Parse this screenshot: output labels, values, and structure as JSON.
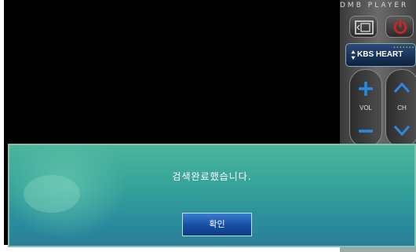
{
  "player": {
    "title": "DMB PLAYER",
    "channel_name": "KBS HEART",
    "vol_label": "VOL",
    "ch_label": "CH"
  },
  "dialog": {
    "message": "검색완료했습니다.",
    "ok_label": "확인"
  },
  "icons": {
    "mode": "screen-mode-icon",
    "power": "power-icon",
    "channel_arrows": "up-down-arrows-icon",
    "vol_up": "plus-icon",
    "vol_down": "minus-icon",
    "ch_up": "chevron-up-icon",
    "ch_down": "chevron-down-icon"
  },
  "colors": {
    "dialog_bg": "#36a39a",
    "button_bg": "#164ea0",
    "power_red": "#e02020",
    "accent_blue": "#2a8ae0"
  }
}
